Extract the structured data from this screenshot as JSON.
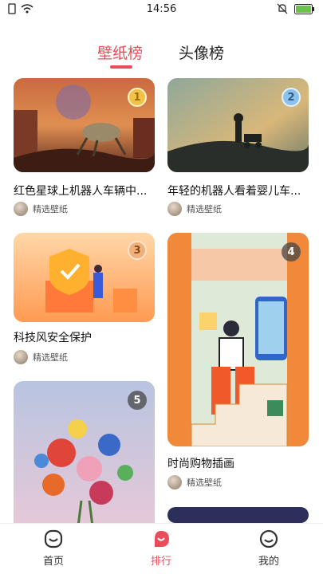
{
  "status_bar": {
    "time": "14:56",
    "battery_color": "#6cc24a"
  },
  "tabs": [
    {
      "label": "壁纸榜",
      "active": true
    },
    {
      "label": "头像榜",
      "active": false
    }
  ],
  "cards": [
    {
      "rank": "1",
      "title": "红色星球上机器人车辆中...",
      "author": "精选壁纸"
    },
    {
      "rank": "2",
      "title": "年轻的机器人看着婴儿车...",
      "author": "精选壁纸"
    },
    {
      "rank": "3",
      "title": "科技风安全保护",
      "author": "精选壁纸"
    },
    {
      "rank": "4",
      "title": "时尚购物插画",
      "author": "精选壁纸"
    },
    {
      "rank": "5",
      "title": "",
      "author": ""
    }
  ],
  "bottom_nav": [
    {
      "label": "首页",
      "icon": "home-face-icon"
    },
    {
      "label": "排行",
      "icon": "ranking-icon",
      "active": true
    },
    {
      "label": "我的",
      "icon": "profile-face-icon"
    }
  ],
  "accent_color": "#e94c5a"
}
